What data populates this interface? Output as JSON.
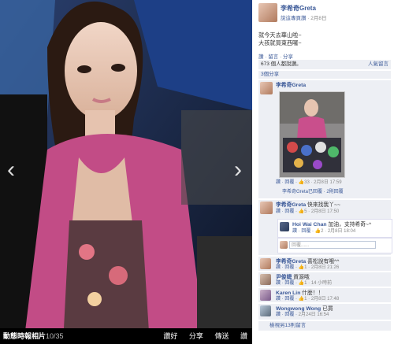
{
  "photo_viewer": {
    "album_label": "動態時報相片",
    "count_label": "10/35",
    "actions": [
      "讚好",
      "分享",
      "傳送",
      "讚"
    ],
    "prev_icon": "chevron-left-icon",
    "next_icon": "chevron-right-icon"
  },
  "post": {
    "author": "李希奇Greta",
    "page_label": "說這專頁讚",
    "date": "2月8日",
    "caption_line1": "就今天去華山啦~",
    "caption_line2": "大孩就買東西囉~",
    "actions": "讚 · 留言 · 分享",
    "likes_text": "673 個人都說讚。",
    "sort_label": "人氣留言",
    "shares_text": "3個分享"
  },
  "comments": [
    {
      "author": "李希奇Greta",
      "text": "",
      "meta_pre": "讚 · 回覆 · ",
      "meta_likes": "33",
      "meta_time": " · 2月8日 17:59",
      "replies_summary": "李希奇Greta已回覆 · 2則回覆"
    },
    {
      "author": "李希奇Greta",
      "text": " 快來找我丫~~",
      "meta_pre": "讚 · 回覆 · ",
      "meta_likes": "5",
      "meta_time": " · 2月8日 17:50"
    },
    {
      "author": "Hoi Wai Chan",
      "text": " 加油，支持希奇~^",
      "meta_pre": "讚 · 回覆 · ",
      "meta_likes": "2",
      "meta_time": " · 2月8日 18:04"
    },
    {
      "author": "李希奇Greta",
      "text": " 喜松說有哦^^",
      "meta_pre": "讚 · 回覆 · ",
      "meta_likes": "1",
      "meta_time": " · 2月8日 21:26"
    },
    {
      "author": "尹俊婕",
      "text": " 資源哦",
      "meta_pre": "讚 · 回覆 · ",
      "meta_likes": "1",
      "meta_time": " · 14 小時前"
    },
    {
      "author": "Karen Lin",
      "text": " 什麼！！",
      "meta_pre": "讚 · 回覆 · ",
      "meta_likes": "1",
      "meta_time": " · 2月8日 17:48"
    },
    {
      "author": "Wongwong Wong",
      "text": " 已買",
      "meta_pre": "讚 · 回覆 · ",
      "meta_likes": "",
      "meta_time": "2月24日 16:54"
    }
  ],
  "reply_placeholder": "回覆......",
  "view_more": "檢視另13則留言"
}
